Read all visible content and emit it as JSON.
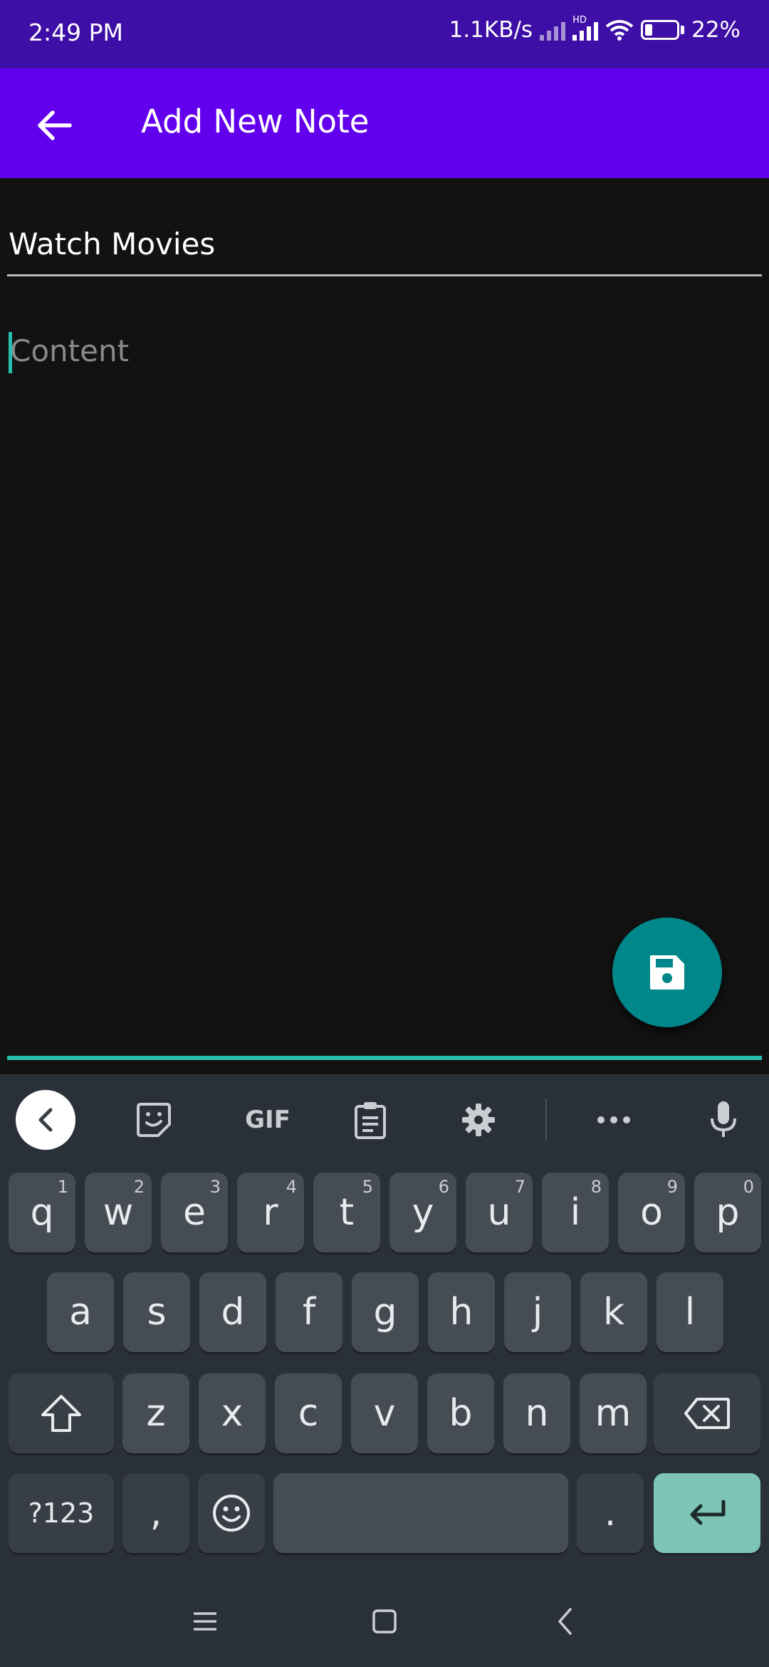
{
  "status_bar": {
    "time": "2:49 PM",
    "net_speed": "1.1KB/s",
    "hd_label": "HD",
    "battery": "22%",
    "battery_level": 0.22
  },
  "app_bar": {
    "title": "Add New Note",
    "back_icon": "arrow-left-icon"
  },
  "editor": {
    "title_value": "Watch Movies",
    "content_value": "",
    "content_placeholder": "Content"
  },
  "fab": {
    "icon": "save-icon"
  },
  "keyboard": {
    "toolbar": {
      "gif_label": "GIF",
      "items": [
        "collapse-icon",
        "sticker-icon",
        "gif",
        "clipboard-icon",
        "settings-icon",
        "more-icon",
        "mic-icon"
      ]
    },
    "rows": [
      [
        {
          "label": "q",
          "hint": "1"
        },
        {
          "label": "w",
          "hint": "2"
        },
        {
          "label": "e",
          "hint": "3"
        },
        {
          "label": "r",
          "hint": "4"
        },
        {
          "label": "t",
          "hint": "5"
        },
        {
          "label": "y",
          "hint": "6"
        },
        {
          "label": "u",
          "hint": "7"
        },
        {
          "label": "i",
          "hint": "8"
        },
        {
          "label": "o",
          "hint": "9"
        },
        {
          "label": "p",
          "hint": "0"
        }
      ],
      [
        {
          "label": "a"
        },
        {
          "label": "s"
        },
        {
          "label": "d"
        },
        {
          "label": "f"
        },
        {
          "label": "g"
        },
        {
          "label": "h"
        },
        {
          "label": "j"
        },
        {
          "label": "k"
        },
        {
          "label": "l"
        }
      ],
      [
        {
          "label": "z"
        },
        {
          "label": "x"
        },
        {
          "label": "c"
        },
        {
          "label": "v"
        },
        {
          "label": "b"
        },
        {
          "label": "n"
        },
        {
          "label": "m"
        }
      ]
    ],
    "symbols_label": "?123",
    "comma_label": ",",
    "period_label": ".",
    "colors": {
      "enter": "#7ec4b7",
      "accent": "#26bfaf"
    }
  },
  "colors": {
    "status_bar": "#3d0fa6",
    "app_bar": "#6200ee",
    "background": "#121212",
    "fab": "#00878a"
  }
}
